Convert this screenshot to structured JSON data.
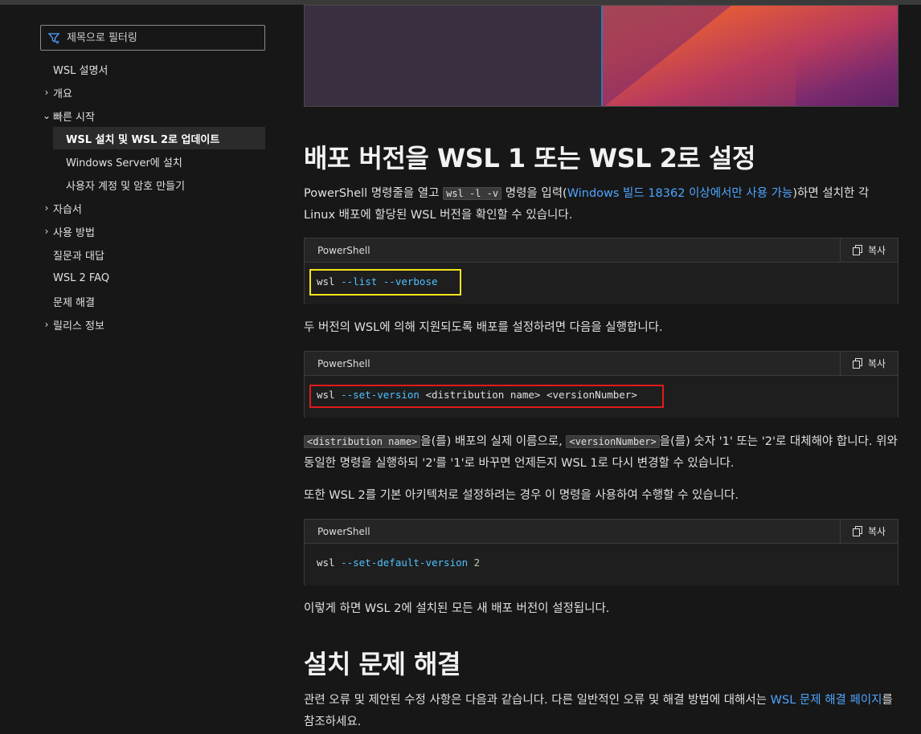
{
  "sidebar": {
    "filter_placeholder": "제목으로 필터링",
    "items": [
      {
        "label": "WSL 설명서",
        "chevron": ""
      },
      {
        "label": "개요",
        "chevron": "›"
      },
      {
        "label": "빠른 시작",
        "chevron": "⌄"
      },
      {
        "label": "WSL 설치 및 WSL 2로 업데이트",
        "chevron": ""
      },
      {
        "label": "Windows Server에 설치",
        "chevron": ""
      },
      {
        "label": "사용자 계정 및 암호 만들기",
        "chevron": ""
      },
      {
        "label": "자습서",
        "chevron": "›"
      },
      {
        "label": "사용 방법",
        "chevron": "›"
      },
      {
        "label": "질문과 대답",
        "chevron": ""
      },
      {
        "label": "WSL 2 FAQ",
        "chevron": ""
      },
      {
        "label": "문제 해결",
        "chevron": ""
      },
      {
        "label": "릴리스 정보",
        "chevron": "›"
      }
    ]
  },
  "main": {
    "heading1": "배포 버전을 WSL 1 또는 WSL 2로 설정",
    "p1": {
      "a": "PowerShell 명령줄을 열고 ",
      "code": "wsl -l -v",
      "b": " 명령을 입력(",
      "link": "Windows 빌드 18362 이상에서만 사용 가능",
      "c": ")하면 설치한 각 Linux 배포에 할당된 WSL 버전을 확인할 수 있습니다."
    },
    "code1": {
      "lang": "PowerShell",
      "copy": "복사",
      "cmd": "wsl",
      "args": " --list --verbose"
    },
    "p2": "두 버전의 WSL에 의해 지원되도록 배포를 설정하려면 다음을 실행합니다.",
    "code2": {
      "lang": "PowerShell",
      "copy": "복사",
      "cmd": "wsl",
      "param": " --set-version",
      "rest": " <distribution name> <versionNumber>"
    },
    "p3": {
      "code_a": "<distribution name>",
      "a": "을(를) 배포의 실제 이름으로, ",
      "code_b": "<versionNumber>",
      "b": "을(를) 숫자 '1' 또는 '2'로 대체해야 합니다. 위와 동일한 명령을 실행하되 '2'를 '1'로 바꾸면 언제든지 WSL 1로 다시 변경할 수 있습니다."
    },
    "p4": "또한 WSL 2를 기본 아키텍처로 설정하려는 경우 이 명령을 사용하여 수행할 수 있습니다.",
    "code3": {
      "lang": "PowerShell",
      "copy": "복사",
      "cmd": "wsl",
      "param": " --set-default-version",
      "num": " 2"
    },
    "p5": "이렇게 하면 WSL 2에 설치된 모든 새 배포 버전이 설정됩니다.",
    "heading2": "설치 문제 해결",
    "p6": {
      "a": "관련 오류 및 제안된 수정 사항은 다음과 같습니다. 다른 일반적인 오류 및 해결 방법에 대해서는 ",
      "link": "WSL 문제 해결 페이지",
      "b": "를 참조하세요."
    }
  },
  "colors": {
    "link": "#4ea5ff",
    "param": "#4fc1ff",
    "highlight_yellow": "#f4e51c",
    "highlight_red": "#e01a1a"
  }
}
